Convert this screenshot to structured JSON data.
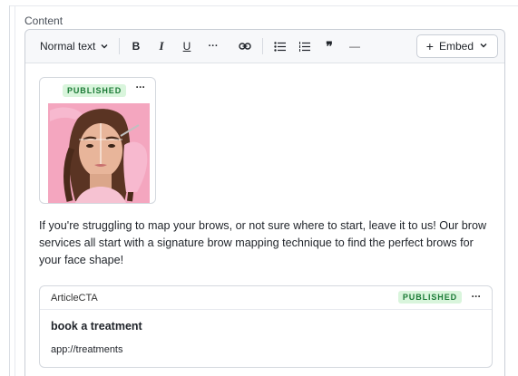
{
  "field": {
    "label": "Content"
  },
  "toolbar": {
    "style_label": "Normal text",
    "bold": "B",
    "italic": "I",
    "underline": "U",
    "more": "···",
    "quote": "❞",
    "rule": "—",
    "embed_label": "Embed",
    "embed_plus": "+"
  },
  "image_block": {
    "status": "PUBLISHED",
    "menu": "···"
  },
  "paragraph": "If you're struggling to map your brows, or not sure where to start, leave it to us! Our brow services all start with a signature brow mapping technique to find the perfect brows for your face shape!",
  "cta": {
    "type": "ArticleCTA",
    "status": "PUBLISHED",
    "menu": "···",
    "title": "book a treatment",
    "url": "app://treatments"
  },
  "colors": {
    "published_bg": "#d9f5dc",
    "published_text": "#1b7a36",
    "photo_background": "#f4a6bf"
  }
}
